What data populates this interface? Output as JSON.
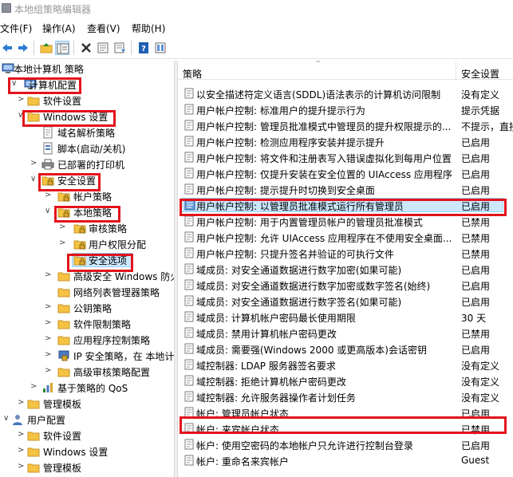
{
  "window": {
    "title": "本地组策略编辑器"
  },
  "menus": [
    "文件(F)",
    "操作(A)",
    "查看(V)",
    "帮助(H)"
  ],
  "toolbar": {
    "buttons": [
      {
        "name": "back-arrow-icon"
      },
      {
        "name": "forward-arrow-icon"
      },
      {
        "name": "up-folder-icon"
      },
      {
        "name": "show-tree-icon",
        "active": true
      },
      {
        "name": "delete-icon"
      },
      {
        "name": "properties-icon"
      },
      {
        "name": "export-list-icon"
      },
      {
        "name": "help-icon"
      },
      {
        "name": "view-icon"
      }
    ]
  },
  "tree": {
    "items": [
      {
        "label": "本地计算机 策略",
        "icon": "computer-icon",
        "chevron": ""
      },
      {
        "label": "计算机配置",
        "icon": "computer-icon",
        "chevron": "v"
      },
      {
        "label": "软件设置",
        "icon": "folder-icon",
        "chevron": ">"
      },
      {
        "label": "Windows 设置",
        "icon": "folder-icon",
        "chevron": "v"
      },
      {
        "label": "域名解析策略",
        "icon": "doc-icon",
        "chevron": ""
      },
      {
        "label": "脚本(启动/关机)",
        "icon": "script-icon",
        "chevron": ""
      },
      {
        "label": "已部署的打印机",
        "icon": "printer-icon",
        "chevron": ">"
      },
      {
        "label": "安全设置",
        "icon": "security-folder-icon",
        "chevron": "v"
      },
      {
        "label": "帐户策略",
        "icon": "security-folder-icon",
        "chevron": ">"
      },
      {
        "label": "本地策略",
        "icon": "security-folder-icon",
        "chevron": "v"
      },
      {
        "label": "审核策略",
        "icon": "security-folder-icon",
        "chevron": ">"
      },
      {
        "label": "用户权限分配",
        "icon": "security-folder-icon",
        "chevron": ">"
      },
      {
        "label": "安全选项",
        "icon": "security-folder-icon",
        "chevron": ""
      },
      {
        "label": "高级安全 Windows 防火",
        "icon": "folder-icon",
        "chevron": ">"
      },
      {
        "label": "网络列表管理器策略",
        "icon": "folder-icon",
        "chevron": ""
      },
      {
        "label": "公钥策略",
        "icon": "folder-icon",
        "chevron": ">"
      },
      {
        "label": "软件限制策略",
        "icon": "folder-icon",
        "chevron": ">"
      },
      {
        "label": "应用程序控制策略",
        "icon": "folder-icon",
        "chevron": ">"
      },
      {
        "label": "IP 安全策略，在 本地计",
        "icon": "ip-security-icon",
        "chevron": ">"
      },
      {
        "label": "高级审核策略配置",
        "icon": "folder-icon",
        "chevron": ">"
      },
      {
        "label": "基于策略的 QoS",
        "icon": "chart-icon",
        "chevron": ">"
      },
      {
        "label": "管理模板",
        "icon": "folder-icon",
        "chevron": ">"
      },
      {
        "label": "用户配置",
        "icon": "user-icon",
        "chevron": "v"
      },
      {
        "label": "软件设置",
        "icon": "folder-icon",
        "chevron": ">"
      },
      {
        "label": "Windows 设置",
        "icon": "folder-icon",
        "chevron": ">"
      },
      {
        "label": "管理模板",
        "icon": "folder-icon",
        "chevron": ">"
      }
    ]
  },
  "list": {
    "col_policy": "策略",
    "col_setting": "安全设置",
    "rows": [
      {
        "policy": "以安全描述符定义语言(SDDL)语法表示的计算机访问限制",
        "setting": "没有定义"
      },
      {
        "policy": "用户帐户控制: 标准用户的提升提示行为",
        "setting": "提示凭据"
      },
      {
        "policy": "用户帐户控制: 管理员批准模式中管理员的提升权限提示的...",
        "setting": "不提示，直接"
      },
      {
        "policy": "用户帐户控制: 检测应用程序安装并提示提升",
        "setting": "已启用"
      },
      {
        "policy": "用户帐户控制: 将文件和注册表写入错误虚拟化到每用户位置",
        "setting": "已启用"
      },
      {
        "policy": "用户帐户控制: 仅提升安装在安全位置的 UIAccess 应用程序",
        "setting": "已启用"
      },
      {
        "policy": "用户帐户控制: 提示提升时切换到安全桌面",
        "setting": "已启用"
      },
      {
        "policy": "用户帐户控制: 以管理员批准模式运行所有管理员",
        "setting": "已启用"
      },
      {
        "policy": "用户帐户控制: 用于内置管理员帐户的管理员批准模式",
        "setting": "已禁用"
      },
      {
        "policy": "用户帐户控制: 允许 UIAccess 应用程序在不使用安全桌面...",
        "setting": "已禁用"
      },
      {
        "policy": "用户帐户控制: 只提升签名并验证的可执行文件",
        "setting": "已禁用"
      },
      {
        "policy": "域成员: 对安全通道数据进行数字加密(如果可能)",
        "setting": "已启用"
      },
      {
        "policy": "域成员: 对安全通道数据进行数字加密或数字签名(始终)",
        "setting": "已启用"
      },
      {
        "policy": "域成员: 对安全通道数据进行数字签名(如果可能)",
        "setting": "已启用"
      },
      {
        "policy": "域成员: 计算机帐户密码最长使用期限",
        "setting": "30 天"
      },
      {
        "policy": "域成员: 禁用计算机帐户密码更改",
        "setting": "已禁用"
      },
      {
        "policy": "域成员: 需要强(Windows 2000 或更高版本)会话密钥",
        "setting": "已启用"
      },
      {
        "policy": "域控制器: LDAP 服务器签名要求",
        "setting": "没有定义"
      },
      {
        "policy": "域控制器: 拒绝计算机帐户密码更改",
        "setting": "没有定义"
      },
      {
        "policy": "域控制器: 允许服务器操作者计划任务",
        "setting": "没有定义"
      },
      {
        "policy": "帐户: 管理员帐户状态",
        "setting": "已启用"
      },
      {
        "policy": "帐户: 来宾帐户状态",
        "setting": "已禁用"
      },
      {
        "policy": "帐户: 使用空密码的本地帐户只允许进行控制台登录",
        "setting": "已启用"
      },
      {
        "policy": "帐户: 重命名来宾帐户",
        "setting": "Guest"
      }
    ]
  },
  "colors": {
    "highlight": "#e3131b",
    "selection": "#cce8ff",
    "folder": "#f5c242"
  }
}
